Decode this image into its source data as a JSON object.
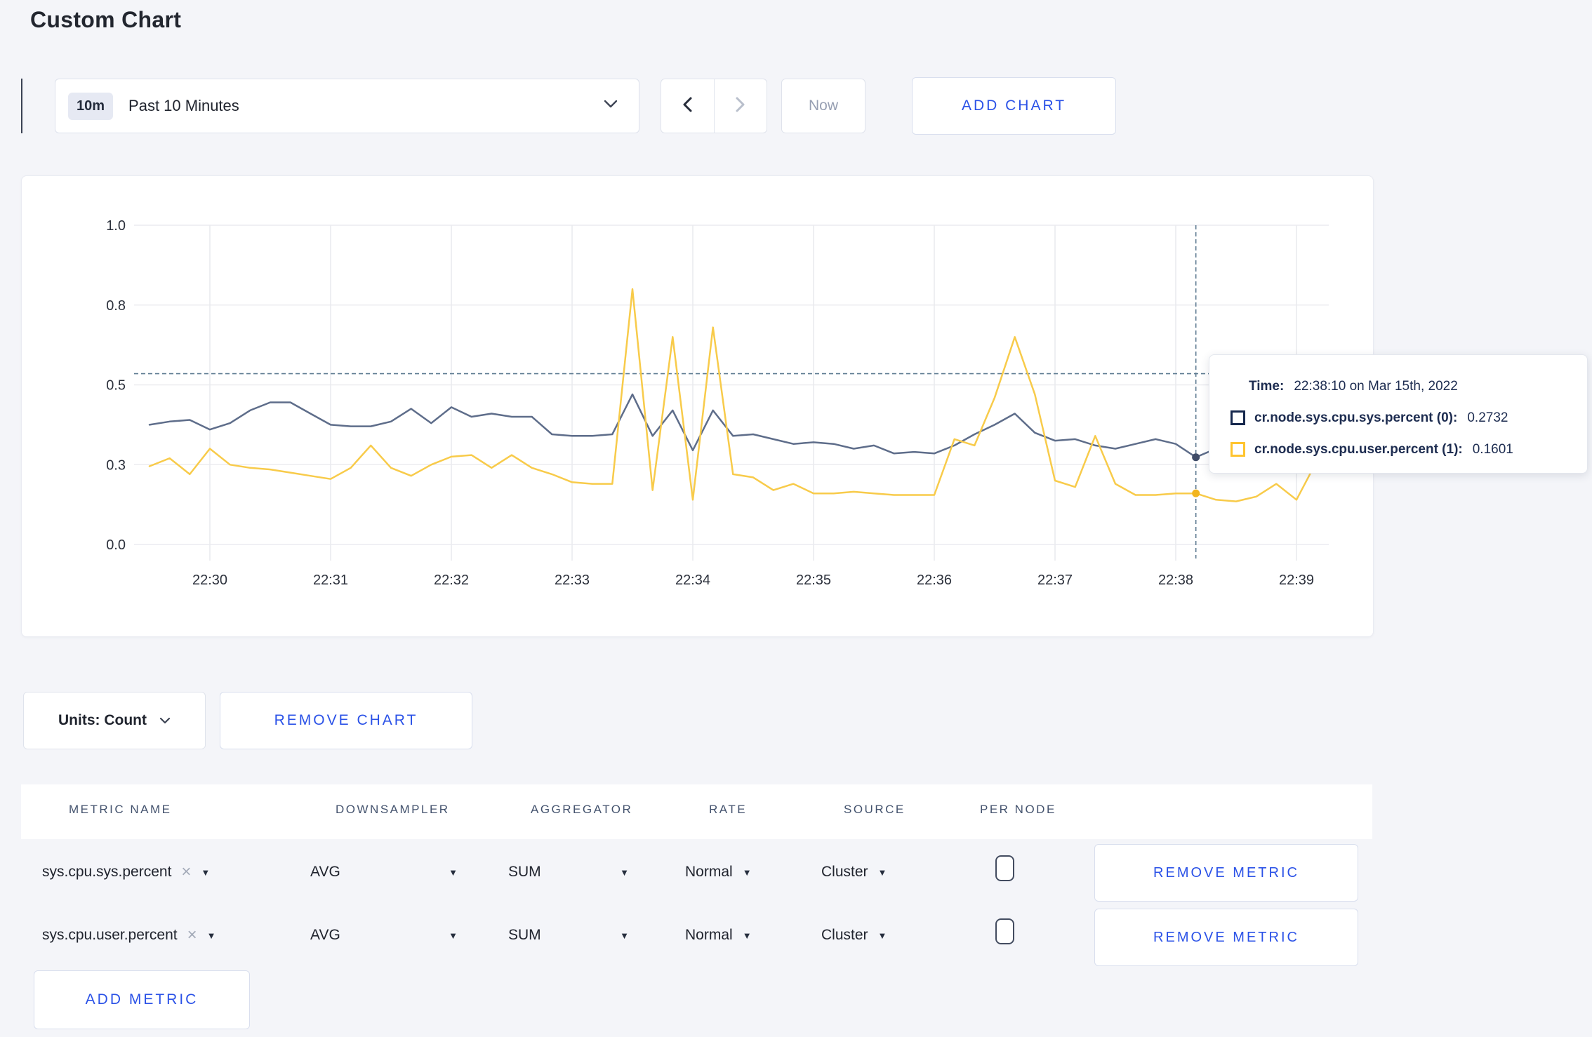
{
  "page": {
    "title": "Custom Chart"
  },
  "toolbar": {
    "time_range_badge": "10m",
    "time_range_label": "Past 10 Minutes",
    "now_button": "Now",
    "add_chart_button": "ADD CHART"
  },
  "chart_data": {
    "type": "line",
    "title": "",
    "xlabel": "",
    "ylabel": "",
    "x_start": "22:29:30",
    "x_interval_seconds": 10,
    "x_tick_labels": [
      "22:30",
      "22:31",
      "22:32",
      "22:33",
      "22:34",
      "22:35",
      "22:36",
      "22:37",
      "22:38",
      "22:39"
    ],
    "ylim": [
      0,
      1
    ],
    "grid": true,
    "y_ticks": [
      {
        "value": 0.0,
        "label": "0.0"
      },
      {
        "value": 0.25,
        "label": "0.3"
      },
      {
        "value": 0.5,
        "label": "0.5"
      },
      {
        "value": 0.75,
        "label": "0.8"
      },
      {
        "value": 1.0,
        "label": "1.0"
      }
    ],
    "series": [
      {
        "name": "cr.node.sys.cpu.sys.percent",
        "color": "#5e6d8a",
        "values": [
          0.375,
          0.385,
          0.39,
          0.36,
          0.38,
          0.42,
          0.445,
          0.445,
          0.41,
          0.375,
          0.37,
          0.37,
          0.385,
          0.425,
          0.38,
          0.43,
          0.4,
          0.41,
          0.4,
          0.4,
          0.345,
          0.34,
          0.34,
          0.345,
          0.47,
          0.34,
          0.42,
          0.295,
          0.42,
          0.34,
          0.345,
          0.33,
          0.315,
          0.32,
          0.315,
          0.3,
          0.31,
          0.285,
          0.29,
          0.285,
          0.31,
          0.345,
          0.375,
          0.41,
          0.35,
          0.325,
          0.33,
          0.31,
          0.3,
          0.315,
          0.33,
          0.315,
          0.2732,
          0.3,
          0.3,
          0.31,
          0.3,
          0.295,
          0.3
        ]
      },
      {
        "name": "cr.node.sys.cpu.user.percent",
        "color": "#f8cb4a",
        "values": [
          0.245,
          0.27,
          0.22,
          0.3,
          0.25,
          0.24,
          0.235,
          0.225,
          0.215,
          0.205,
          0.24,
          0.31,
          0.24,
          0.215,
          0.25,
          0.275,
          0.28,
          0.24,
          0.28,
          0.24,
          0.22,
          0.195,
          0.19,
          0.19,
          0.8,
          0.17,
          0.65,
          0.14,
          0.68,
          0.22,
          0.21,
          0.17,
          0.19,
          0.16,
          0.16,
          0.165,
          0.16,
          0.155,
          0.155,
          0.155,
          0.33,
          0.31,
          0.46,
          0.65,
          0.47,
          0.2,
          0.18,
          0.34,
          0.19,
          0.155,
          0.155,
          0.16,
          0.1601,
          0.14,
          0.135,
          0.15,
          0.19,
          0.14,
          0.26
        ]
      }
    ],
    "hover": {
      "index": 52,
      "time": "22:38:10",
      "crosshair_value": 0.535,
      "values": [
        0.2732,
        0.1601
      ],
      "dot_colors": [
        "#3f4c68",
        "#f2b51e"
      ]
    }
  },
  "tooltip": {
    "time_label": "Time:",
    "time_value": "22:38:10 on Mar 15th, 2022",
    "rows": [
      {
        "name": "cr.node.sys.cpu.sys.percent (0):",
        "value": "0.2732",
        "swatch_color": "#16284d"
      },
      {
        "name": "cr.node.sys.cpu.user.percent (1):",
        "value": "0.1601",
        "swatch_color": "#ffc42e"
      }
    ]
  },
  "chart_footer": {
    "units_button": "Units: Count",
    "remove_chart_button": "REMOVE CHART"
  },
  "metrics_table": {
    "headers": [
      "METRIC NAME",
      "DOWNSAMPLER",
      "AGGREGATOR",
      "RATE",
      "SOURCE",
      "PER NODE"
    ],
    "rows": [
      {
        "metric": "sys.cpu.sys.percent",
        "downsampler": "AVG",
        "aggregator": "SUM",
        "rate": "Normal",
        "source": "Cluster",
        "per_node_checked": false,
        "remove_button": "REMOVE METRIC"
      },
      {
        "metric": "sys.cpu.user.percent",
        "downsampler": "AVG",
        "aggregator": "SUM",
        "rate": "Normal",
        "source": "Cluster",
        "per_node_checked": false,
        "remove_button": "REMOVE METRIC"
      }
    ],
    "add_metric_button": "ADD METRIC"
  },
  "icons": {
    "close_x": "×",
    "caret_down": "▼"
  }
}
